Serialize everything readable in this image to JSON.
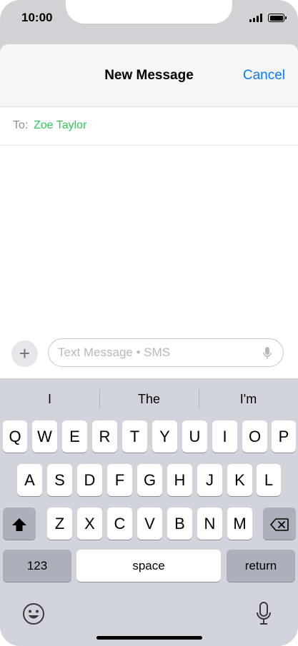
{
  "status_bar": {
    "time": "10:00"
  },
  "nav": {
    "title": "New Message",
    "cancel_label": "Cancel"
  },
  "recipient": {
    "to_label": "To:",
    "name": "Zoe Taylor"
  },
  "compose": {
    "placeholder": "Text Message • SMS",
    "plus_label": "+"
  },
  "keyboard": {
    "suggestions": [
      "I",
      "The",
      "I'm"
    ],
    "row1": [
      "Q",
      "W",
      "E",
      "R",
      "T",
      "Y",
      "U",
      "I",
      "O",
      "P"
    ],
    "row2": [
      "A",
      "S",
      "D",
      "F",
      "G",
      "H",
      "J",
      "K",
      "L"
    ],
    "row3": [
      "Z",
      "X",
      "C",
      "V",
      "B",
      "N",
      "M"
    ],
    "numbers_label": "123",
    "space_label": "space",
    "return_label": "return"
  },
  "colors": {
    "accent": "#0a7aff",
    "recipient": "#34c759"
  },
  "icons": [
    "signal-icon",
    "battery-icon",
    "add-icon",
    "microphone-icon",
    "shift-icon",
    "backspace-icon",
    "emoji-icon",
    "dictation-icon"
  ]
}
